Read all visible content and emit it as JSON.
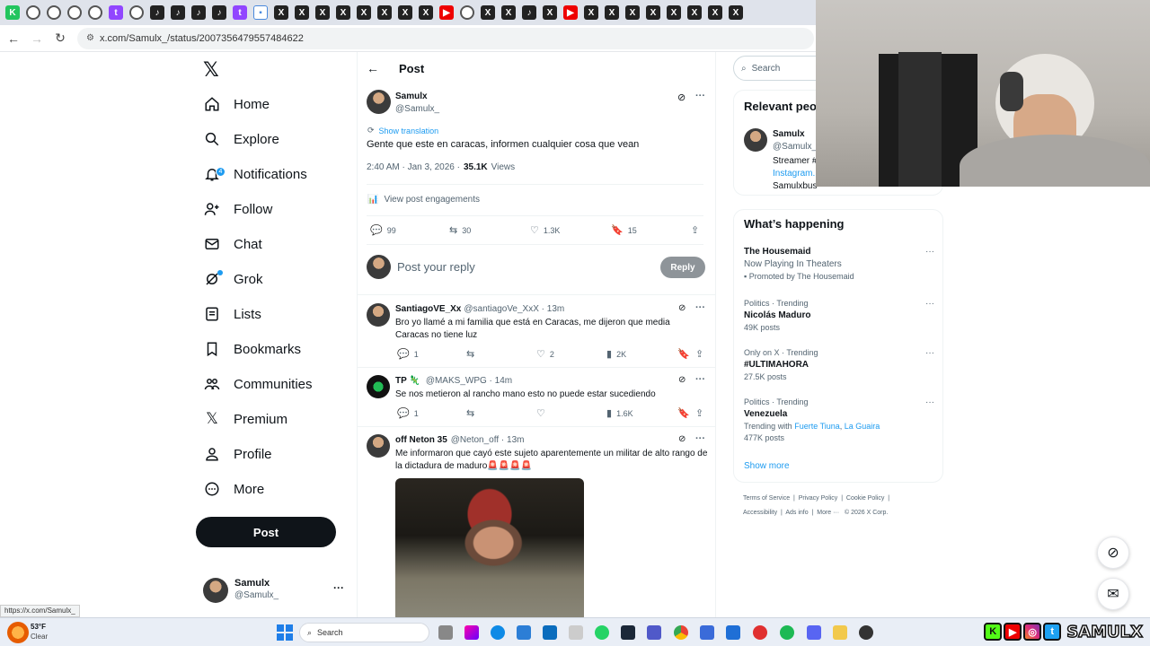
{
  "browser": {
    "url": "x.com/Samulx_/status/2007356479557484622",
    "status_url": "https://x.com/Samulx_"
  },
  "leftnav": {
    "items": [
      {
        "label": "Home",
        "icon": "home-icon"
      },
      {
        "label": "Explore",
        "icon": "search-icon"
      },
      {
        "label": "Notifications",
        "icon": "bell-icon",
        "badge": "4"
      },
      {
        "label": "Follow",
        "icon": "person-add-icon"
      },
      {
        "label": "Chat",
        "icon": "mail-icon"
      },
      {
        "label": "Grok",
        "icon": "grok-icon"
      },
      {
        "label": "Lists",
        "icon": "list-icon"
      },
      {
        "label": "Bookmarks",
        "icon": "bookmark-icon"
      },
      {
        "label": "Communities",
        "icon": "people-icon"
      },
      {
        "label": "Premium",
        "icon": "x-icon"
      },
      {
        "label": "Profile",
        "icon": "person-icon"
      },
      {
        "label": "More",
        "icon": "more-circle-icon"
      }
    ],
    "post_button": "Post",
    "account": {
      "name": "Samulx",
      "handle": "@Samulx_"
    }
  },
  "main": {
    "header": "Post",
    "post": {
      "name": "Samulx",
      "handle": "@Samulx_",
      "translation": "Show translation",
      "text": "Gente que este en caracas, informen cualquier cosa que vean",
      "time": "2:40 AM · Jan 3, 2026 ·",
      "views_count": "35.1K",
      "views_label": "Views",
      "engagements": "View post engagements",
      "replies": "99",
      "reposts": "30",
      "likes": "1.3K",
      "bookmarks": "15"
    },
    "reply_box": {
      "placeholder": "Post your reply",
      "button": "Reply"
    },
    "replies": [
      {
        "name": "SantiagoVE_Xx",
        "handle": "@santiagoVe_XxX · 13m",
        "text": "Bro yo llamé a mi familia que está en Caracas, me dijeron que media Caracas no tiene luz",
        "replies": "1",
        "reposts": "",
        "likes": "2",
        "views": "2K"
      },
      {
        "name": "TP 🦎",
        "handle": "@MAKS_WPG · 14m",
        "text": "Se nos metieron al rancho mano esto no puede estar sucediendo",
        "replies": "1",
        "reposts": "",
        "likes": "",
        "views": "1.6K"
      },
      {
        "name": "off Neton 35",
        "handle": "@Neton_off · 13m",
        "text": "Me informaron que cayó este sujeto aparentemente un militar de alto rango de la dictadura de maduro🚨🚨🚨🚨"
      }
    ]
  },
  "right": {
    "search_placeholder": "Search",
    "relevant": {
      "title": "Relevant peo",
      "name": "Samulx",
      "handle": "@Samulx_",
      "bio1": "Streamer #",
      "bio2": "Instagram.",
      "bio3": "Samulxbus"
    },
    "happening": {
      "title": "What’s happening",
      "trends": [
        {
          "cat": "",
          "title": "The Housemaid",
          "sub": "Now Playing In Theaters",
          "promo": "Promoted by The Housemaid"
        },
        {
          "cat": "Politics · Trending",
          "title": "Nicolás Maduro",
          "sub": "49K posts"
        },
        {
          "cat": "Only on X · Trending",
          "title": "#ULTIMAHORA",
          "sub": "27.5K posts"
        },
        {
          "cat": "Politics · Trending",
          "title": "Venezuela",
          "sub_prefix": "Trending with",
          "sub_link1": "Fuerte Tiuna",
          "sub_link2": "La Guaira",
          "sub2": "477K posts"
        }
      ],
      "show_more": "Show more"
    },
    "footer": {
      "terms": "Terms of Service",
      "privacy": "Privacy Policy",
      "cookie": "Cookie Policy",
      "accessibility": "Accessibility",
      "ads": "Ads info",
      "more": "More ···",
      "copyright": "© 2026 X Corp."
    }
  },
  "taskbar": {
    "temp": "53°F",
    "weather": "Clear",
    "search": "Search",
    "brand": "SAMULX"
  },
  "colors": {
    "accent": "#1d9bf0",
    "text": "#0f1419",
    "muted": "#536471"
  }
}
